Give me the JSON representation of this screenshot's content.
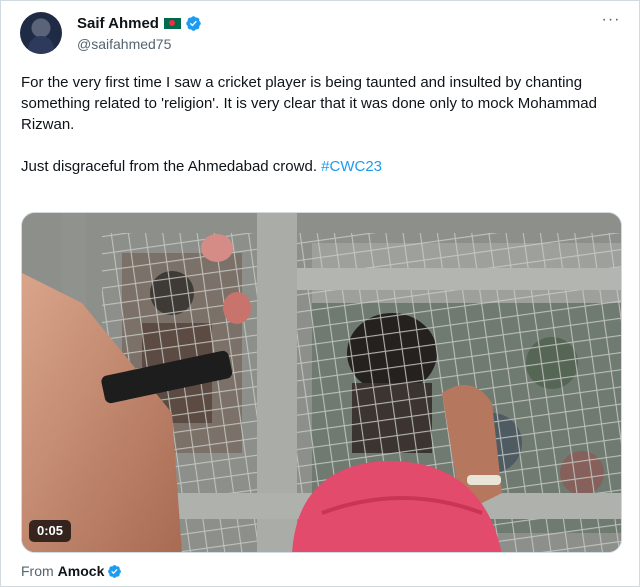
{
  "author": {
    "display_name": "Saif Ahmed",
    "handle": "@saifahmed75",
    "flag_icon": "bangladesh-flag-icon",
    "verified_icon": "verified-badge-icon",
    "verified_color": "#1d9bf0"
  },
  "more_button": {
    "icon": "more-horizontal-icon",
    "label": "···"
  },
  "tweet": {
    "paragraph_1": "For the very first time I saw a cricket player is being taunted and insulted by chanting something related to 'religion'. It is very clear that it was done only to mock Mohammad Rizwan.",
    "paragraph_2_text": "Just disgraceful from the Ahmedabad crowd. ",
    "hashtag": "#CWC23",
    "hashtag_color": "#1d9bf0"
  },
  "video": {
    "timestamp": "0:05"
  },
  "source": {
    "label": "From",
    "name": "Amock"
  }
}
